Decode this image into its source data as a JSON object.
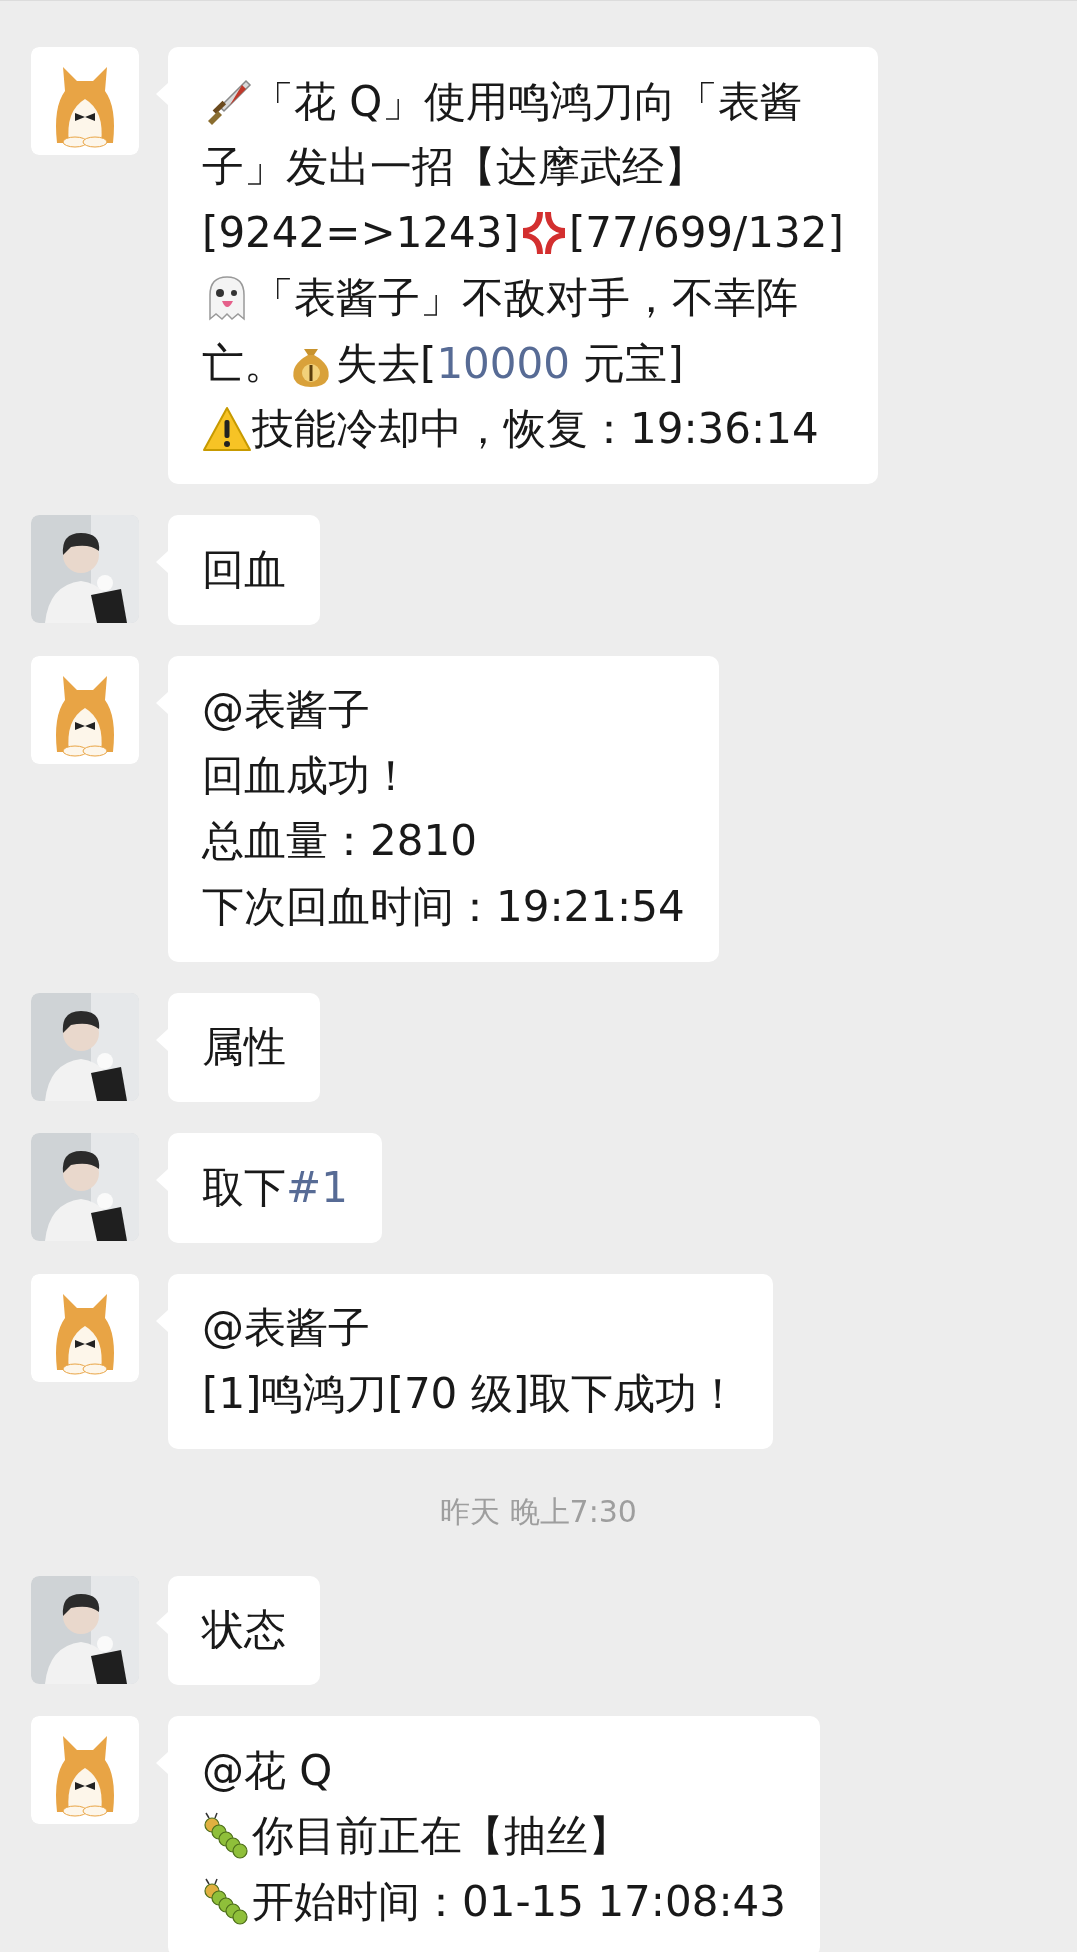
{
  "chat": [
    {
      "kind": "bot",
      "lines": [
        [
          {
            "kind": "sword"
          },
          {
            "kind": "text",
            "text": "「花 Q」使用鸣鸿刀向「表酱"
          }
        ],
        [
          {
            "kind": "text",
            "text": "子」发出一招【达摩武经】"
          }
        ],
        [
          {
            "kind": "text",
            "text": "[9242=>1243]"
          },
          {
            "kind": "anger"
          },
          {
            "kind": "text",
            "text": "[77/699/132]"
          }
        ],
        [
          {
            "kind": "ghost"
          },
          {
            "kind": "text",
            "text": "「表酱子」不敌对手，不幸阵"
          }
        ],
        [
          {
            "kind": "text",
            "text": "亡。"
          },
          {
            "kind": "moneybag"
          },
          {
            "kind": "text",
            "text": "失去["
          },
          {
            "kind": "link",
            "text": "10000"
          },
          {
            "kind": "text",
            "text": " 元宝]"
          }
        ],
        [
          {
            "kind": "warning"
          },
          {
            "kind": "text",
            "text": "技能冷却中，恢复：19:36:14"
          }
        ]
      ]
    },
    {
      "kind": "user",
      "lines": [
        [
          {
            "kind": "text",
            "text": "回血"
          }
        ]
      ]
    },
    {
      "kind": "bot",
      "lines": [
        [
          {
            "kind": "text",
            "text": "@表酱子"
          }
        ],
        [
          {
            "kind": "text",
            "text": "回血成功！"
          }
        ],
        [
          {
            "kind": "text",
            "text": "总血量：2810"
          }
        ],
        [
          {
            "kind": "text",
            "text": "下次回血时间：19:21:54"
          }
        ]
      ]
    },
    {
      "kind": "user",
      "lines": [
        [
          {
            "kind": "text",
            "text": "属性"
          }
        ]
      ]
    },
    {
      "kind": "user",
      "lines": [
        [
          {
            "kind": "text",
            "text": "取下"
          },
          {
            "kind": "link",
            "text": "#1"
          }
        ]
      ]
    },
    {
      "kind": "bot",
      "lines": [
        [
          {
            "kind": "text",
            "text": "@表酱子"
          }
        ],
        [
          {
            "kind": "text",
            "text": "[1]鸣鸿刀[70 级]取下成功！"
          }
        ]
      ]
    },
    {
      "kind": "time",
      "text": "昨天 晚上7:30"
    },
    {
      "kind": "user",
      "lines": [
        [
          {
            "kind": "text",
            "text": "状态"
          }
        ]
      ]
    },
    {
      "kind": "bot",
      "lines": [
        [
          {
            "kind": "text",
            "text": "@花 Q"
          }
        ],
        [
          {
            "kind": "caterpillar"
          },
          {
            "kind": "text",
            "text": "你目前正在【抽丝】"
          }
        ],
        [
          {
            "kind": "caterpillar"
          },
          {
            "kind": "text",
            "text": "开始时间：01-15 17:08:43"
          }
        ]
      ]
    }
  ]
}
